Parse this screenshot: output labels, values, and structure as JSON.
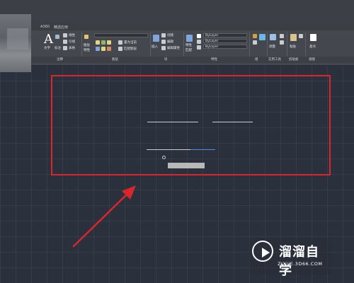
{
  "ribbon": {
    "tabs": [
      "A360",
      "精选应用"
    ],
    "groups": [
      "注释",
      "图层",
      "块",
      "特性",
      "组",
      "实用工具",
      "剪贴板",
      "视图"
    ],
    "draw_labels": [
      "文字",
      "标注",
      "线性",
      "引线",
      "表格"
    ],
    "layer_labels": [
      "图层",
      "特性",
      "置为当前",
      "匹配图层"
    ],
    "block_labels": [
      "插入",
      "创建",
      "编辑",
      "编辑属性"
    ],
    "property_labels": [
      "特性",
      "匹配"
    ],
    "property_dropdowns": [
      "ByLayer",
      "ByLayer",
      "ByLayer"
    ],
    "utility_labels": [
      "测量"
    ],
    "clipboard_labels": [
      "粘贴"
    ],
    "view_labels": [
      "基点"
    ]
  },
  "colors": {
    "highlight": "#d9262c",
    "canvas": "#2a313c",
    "ribbon": "#44484e"
  },
  "watermark": {
    "title": "溜溜自学",
    "url": "ZIXUE.3D66.COM",
    "icon": "play-circle-icon"
  }
}
